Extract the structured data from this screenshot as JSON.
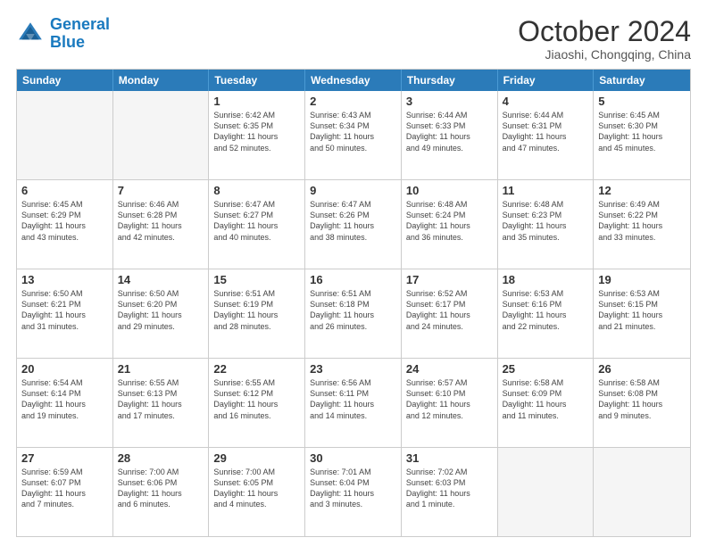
{
  "header": {
    "logo_line1": "General",
    "logo_line2": "Blue",
    "month_title": "October 2024",
    "location": "Jiaoshi, Chongqing, China"
  },
  "weekdays": [
    "Sunday",
    "Monday",
    "Tuesday",
    "Wednesday",
    "Thursday",
    "Friday",
    "Saturday"
  ],
  "rows": [
    [
      {
        "day": "",
        "empty": true
      },
      {
        "day": "",
        "empty": true
      },
      {
        "day": "1",
        "rise": "6:42 AM",
        "set": "6:35 PM",
        "daylight": "11 hours and 52 minutes."
      },
      {
        "day": "2",
        "rise": "6:43 AM",
        "set": "6:34 PM",
        "daylight": "11 hours and 50 minutes."
      },
      {
        "day": "3",
        "rise": "6:44 AM",
        "set": "6:33 PM",
        "daylight": "11 hours and 49 minutes."
      },
      {
        "day": "4",
        "rise": "6:44 AM",
        "set": "6:31 PM",
        "daylight": "11 hours and 47 minutes."
      },
      {
        "day": "5",
        "rise": "6:45 AM",
        "set": "6:30 PM",
        "daylight": "11 hours and 45 minutes."
      }
    ],
    [
      {
        "day": "6",
        "rise": "6:45 AM",
        "set": "6:29 PM",
        "daylight": "11 hours and 43 minutes."
      },
      {
        "day": "7",
        "rise": "6:46 AM",
        "set": "6:28 PM",
        "daylight": "11 hours and 42 minutes."
      },
      {
        "day": "8",
        "rise": "6:47 AM",
        "set": "6:27 PM",
        "daylight": "11 hours and 40 minutes."
      },
      {
        "day": "9",
        "rise": "6:47 AM",
        "set": "6:26 PM",
        "daylight": "11 hours and 38 minutes."
      },
      {
        "day": "10",
        "rise": "6:48 AM",
        "set": "6:24 PM",
        "daylight": "11 hours and 36 minutes."
      },
      {
        "day": "11",
        "rise": "6:48 AM",
        "set": "6:23 PM",
        "daylight": "11 hours and 35 minutes."
      },
      {
        "day": "12",
        "rise": "6:49 AM",
        "set": "6:22 PM",
        "daylight": "11 hours and 33 minutes."
      }
    ],
    [
      {
        "day": "13",
        "rise": "6:50 AM",
        "set": "6:21 PM",
        "daylight": "11 hours and 31 minutes."
      },
      {
        "day": "14",
        "rise": "6:50 AM",
        "set": "6:20 PM",
        "daylight": "11 hours and 29 minutes."
      },
      {
        "day": "15",
        "rise": "6:51 AM",
        "set": "6:19 PM",
        "daylight": "11 hours and 28 minutes."
      },
      {
        "day": "16",
        "rise": "6:51 AM",
        "set": "6:18 PM",
        "daylight": "11 hours and 26 minutes."
      },
      {
        "day": "17",
        "rise": "6:52 AM",
        "set": "6:17 PM",
        "daylight": "11 hours and 24 minutes."
      },
      {
        "day": "18",
        "rise": "6:53 AM",
        "set": "6:16 PM",
        "daylight": "11 hours and 22 minutes."
      },
      {
        "day": "19",
        "rise": "6:53 AM",
        "set": "6:15 PM",
        "daylight": "11 hours and 21 minutes."
      }
    ],
    [
      {
        "day": "20",
        "rise": "6:54 AM",
        "set": "6:14 PM",
        "daylight": "11 hours and 19 minutes."
      },
      {
        "day": "21",
        "rise": "6:55 AM",
        "set": "6:13 PM",
        "daylight": "11 hours and 17 minutes."
      },
      {
        "day": "22",
        "rise": "6:55 AM",
        "set": "6:12 PM",
        "daylight": "11 hours and 16 minutes."
      },
      {
        "day": "23",
        "rise": "6:56 AM",
        "set": "6:11 PM",
        "daylight": "11 hours and 14 minutes."
      },
      {
        "day": "24",
        "rise": "6:57 AM",
        "set": "6:10 PM",
        "daylight": "11 hours and 12 minutes."
      },
      {
        "day": "25",
        "rise": "6:58 AM",
        "set": "6:09 PM",
        "daylight": "11 hours and 11 minutes."
      },
      {
        "day": "26",
        "rise": "6:58 AM",
        "set": "6:08 PM",
        "daylight": "11 hours and 9 minutes."
      }
    ],
    [
      {
        "day": "27",
        "rise": "6:59 AM",
        "set": "6:07 PM",
        "daylight": "11 hours and 7 minutes."
      },
      {
        "day": "28",
        "rise": "7:00 AM",
        "set": "6:06 PM",
        "daylight": "11 hours and 6 minutes."
      },
      {
        "day": "29",
        "rise": "7:00 AM",
        "set": "6:05 PM",
        "daylight": "11 hours and 4 minutes."
      },
      {
        "day": "30",
        "rise": "7:01 AM",
        "set": "6:04 PM",
        "daylight": "11 hours and 3 minutes."
      },
      {
        "day": "31",
        "rise": "7:02 AM",
        "set": "6:03 PM",
        "daylight": "11 hours and 1 minute."
      },
      {
        "day": "",
        "empty": true
      },
      {
        "day": "",
        "empty": true
      }
    ]
  ],
  "labels": {
    "sunrise": "Sunrise:",
    "sunset": "Sunset:",
    "daylight": "Daylight: "
  }
}
